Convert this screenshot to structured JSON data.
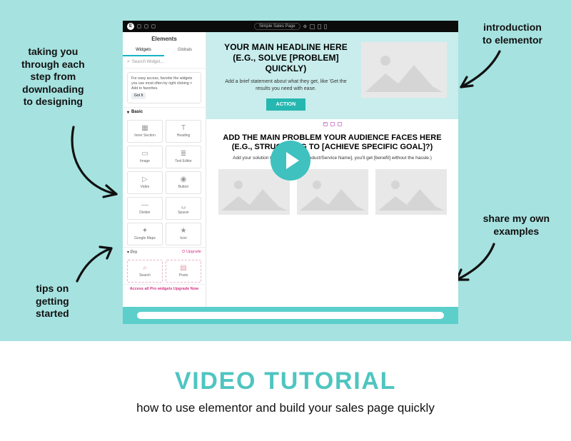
{
  "annotations": {
    "intro": "introduction\nto elementor",
    "steps": "taking you\nthrough each\nstep from\ndownloading\nto designing",
    "examples": "share my own\nexamples",
    "tips": "tips on\ngetting\nstarted"
  },
  "video": {
    "topbar": {
      "pageName": "Simple Sales Page"
    },
    "sidebar": {
      "title": "Elements",
      "tabs": {
        "widgets": "Widgets",
        "globals": "Globals"
      },
      "searchPlaceholder": "Search Widget...",
      "tip": {
        "text": "For easy access, favorite the widgets you use most often by right clicking > Add to favorites.",
        "btn": "Got It"
      },
      "basicLabel": "Basic",
      "basic": [
        {
          "icon": "▦",
          "name": "Inner Section"
        },
        {
          "icon": "T",
          "name": "Heading"
        },
        {
          "icon": "▭",
          "name": "Image"
        },
        {
          "icon": "≣",
          "name": "Text Editor"
        },
        {
          "icon": "▷",
          "name": "Video"
        },
        {
          "icon": "◉",
          "name": "Button"
        },
        {
          "icon": "—",
          "name": "Divider"
        },
        {
          "icon": "␣",
          "name": "Spacer"
        },
        {
          "icon": "✦",
          "name": "Google Maps"
        },
        {
          "icon": "★",
          "name": "Icon"
        }
      ],
      "proLabel": "Pro",
      "upgrade": "⭘ Upgrade",
      "pro": [
        {
          "icon": "⌕",
          "name": "Search"
        },
        {
          "icon": "▤",
          "name": "Posts"
        }
      ],
      "accessText": "Access all Pro widgets",
      "accessLink": "Upgrade Now"
    },
    "page": {
      "heroHeadline": "YOUR MAIN HEADLINE HERE (E.G., SOLVE [PROBLEM] QUICKLY)",
      "heroSub": "Add a brief statement about what they get, like 'Get the results you need with ease.",
      "cta": "ACTION",
      "problemHeadline": "ADD THE MAIN PROBLEM YOUR AUDIENCE FACES HERE (E.G., STRUGGLING TO [ACHIEVE SPECIFIC GOAL]?)",
      "problemSub": "Add your solution here (e.g., With [Product/Service Name], you'll get [benefit] without the hassle.)"
    }
  },
  "bottom": {
    "title": "VIDEO TUTORIAL",
    "subtitle": "how to use elementor and build your sales page quickly"
  }
}
